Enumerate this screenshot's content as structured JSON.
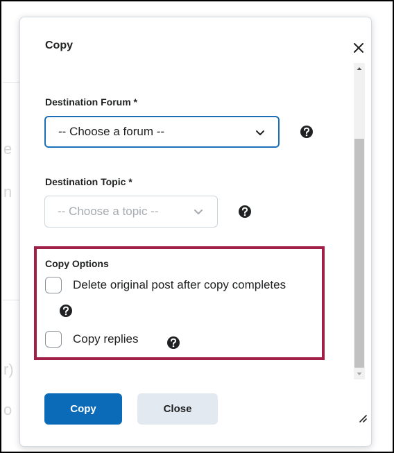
{
  "background": {
    "fragments": [
      "e",
      "n",
      "r)",
      "o"
    ]
  },
  "dialog": {
    "title": "Copy",
    "close_icon": "close-icon",
    "destination_forum": {
      "label": "Destination Forum *",
      "selected": "-- Choose a forum --",
      "help_icon": "help-icon"
    },
    "destination_topic": {
      "label": "Destination Topic *",
      "selected": "-- Choose a topic --",
      "help_icon": "help-icon"
    },
    "copy_options": {
      "label": "Copy Options",
      "delete_original": {
        "label": "Delete original post after copy completes",
        "checked": false
      },
      "copy_replies": {
        "label": "Copy replies",
        "checked": false
      }
    },
    "buttons": {
      "copy": "Copy",
      "close": "Close"
    }
  },
  "colors": {
    "primary": "#0b6bb9",
    "focus_border": "#1a6fb8",
    "highlight_box": "#a01f46",
    "secondary_button": "#e3e9f1"
  }
}
